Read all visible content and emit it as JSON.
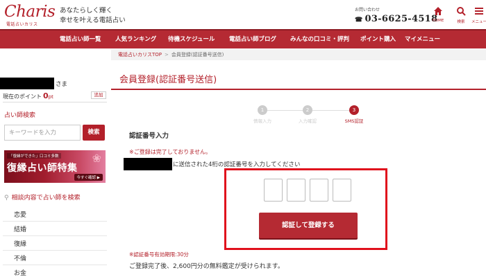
{
  "header": {
    "logo_text": "Charis",
    "logo_sub": "電話占いカリス",
    "tagline_line1": "あなたらしく輝く",
    "tagline_line2": "幸せを叶える電話占い",
    "contact_label": "お問い合わせ",
    "phone": "03-6625-4518",
    "icons": [
      {
        "name": "home-icon",
        "label": "HOME"
      },
      {
        "name": "search-icon",
        "label": "検索"
      },
      {
        "name": "menu-icon",
        "label": "メニュー"
      }
    ]
  },
  "nav": {
    "items": [
      "電話占い師一覧",
      "人気ランキング",
      "待機スケジュール",
      "電話占い師ブログ",
      "みんなの口コミ・評判",
      "ポイント購入",
      "マイメニュー"
    ]
  },
  "breadcrumb": {
    "home": "電話占いカリスTOP",
    "separator": ">",
    "current": "会員登録(認証番号送信)"
  },
  "sidebar": {
    "honorific": "さま",
    "points_label": "現在のポイント",
    "points_value": "0",
    "points_unit": "pt",
    "add_label": "追加",
    "search_title": "占い師検索",
    "keyword_placeholder": "キーワードを入力",
    "search_button": "検索",
    "banner": {
      "top_text": "「復縁ができた」口コミ多数",
      "main_text": "復縁占い師特集",
      "cta": "今すぐ確認 ▶"
    },
    "consult_title": "相談内容で占い師を検索",
    "categories": [
      "恋愛",
      "結婚",
      "復縁",
      "不倫",
      "お金"
    ]
  },
  "main": {
    "title": "会員登録(認証番号送信)",
    "steps": [
      {
        "num": "1",
        "label": "情報入力",
        "active": false
      },
      {
        "num": "2",
        "label": "入力確認",
        "active": false
      },
      {
        "num": "3",
        "label": "SMS認証",
        "active": true
      }
    ],
    "section_label": "認証番号入力",
    "warning": "※ご登録は完了しておりません。",
    "instruction": "に送信された4桁の認証番号を入力してください",
    "code_values": [
      "",
      "",
      "",
      ""
    ],
    "submit_label": "認証して登録する",
    "validity": "※認証番号有効期限:30分",
    "benefit": "ご登録完了後、2,600円分の無料鑑定が受けられます。"
  },
  "colors": {
    "brand": "#b3202a",
    "highlight": "#e0101c"
  }
}
